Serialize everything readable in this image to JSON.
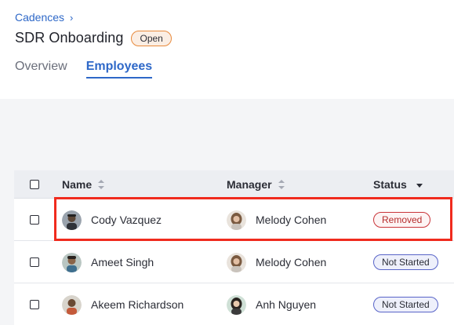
{
  "breadcrumb": {
    "parent": "Cadences",
    "chevron": "›"
  },
  "page": {
    "title": "SDR Onboarding",
    "status": "Open"
  },
  "tabs": [
    {
      "label": "Overview",
      "active": false
    },
    {
      "label": "Employees",
      "active": true
    }
  ],
  "table": {
    "columns": {
      "name": "Name",
      "manager": "Manager",
      "status": "Status"
    },
    "rows": [
      {
        "name": "Cody Vazquez",
        "manager": "Melody Cohen",
        "status": "Removed",
        "highlighted": true
      },
      {
        "name": "Ameet Singh",
        "manager": "Melody Cohen",
        "status": "Not Started",
        "highlighted": false
      },
      {
        "name": "Akeem Richardson",
        "manager": "Anh Nguyen",
        "status": "Not Started",
        "highlighted": false
      }
    ]
  },
  "colors": {
    "accent": "#2e68c8",
    "highlight": "#f02b1e",
    "removed": "#c9353a",
    "not_started": "#5864c8",
    "open_pill": "#e88a3c"
  }
}
